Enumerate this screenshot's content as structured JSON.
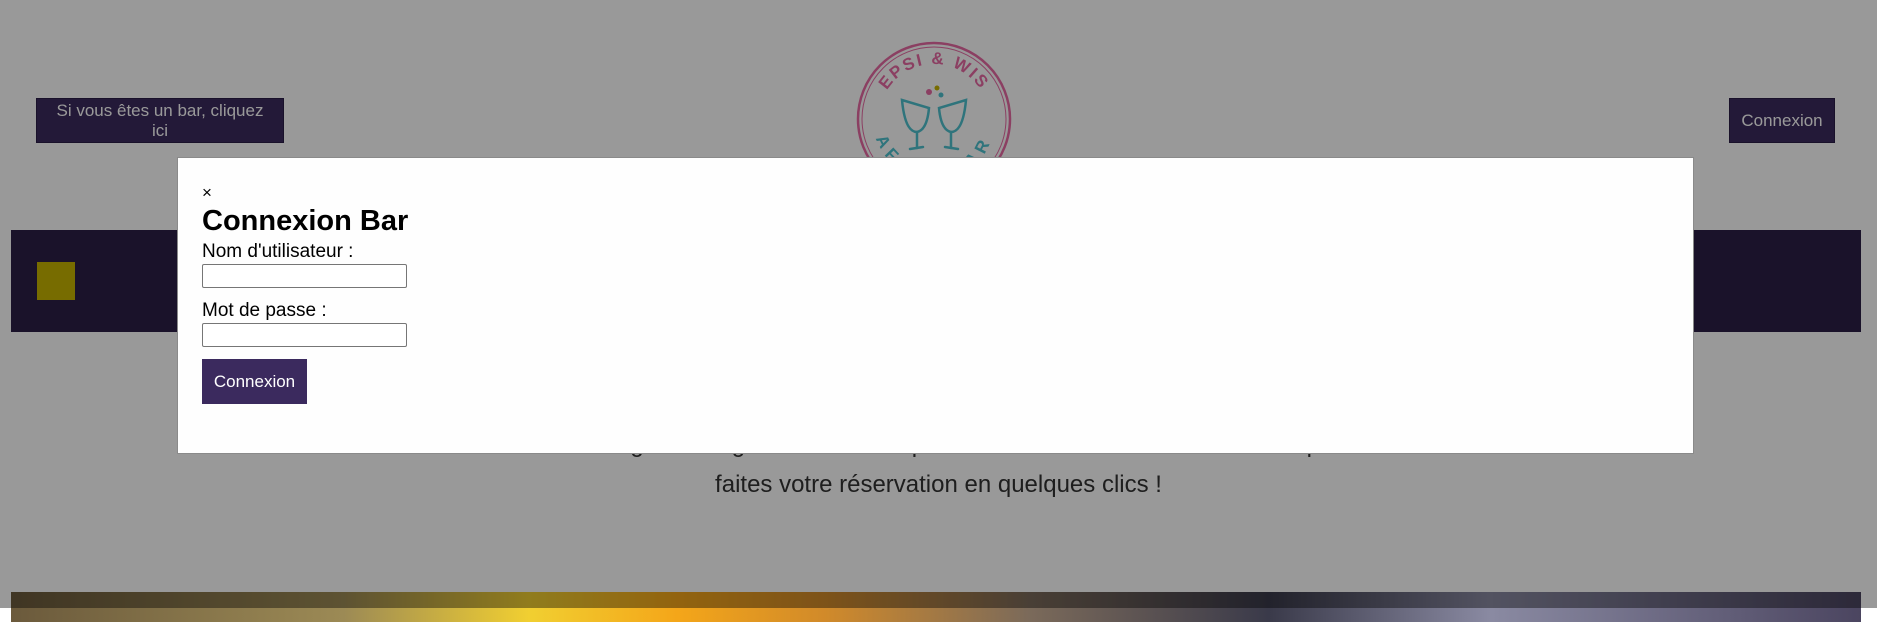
{
  "header": {
    "bar_button_label": "Si vous êtes un bar, cliquez ici",
    "login_button_label": "Connexion",
    "logo": {
      "top_text": "EPSI & WIS",
      "bottom_text": "AFTER BAR",
      "icon": "clinking-glasses-icon",
      "colors": {
        "ring": "#e86aa4",
        "text_top": "#e86aa4",
        "text_bottom": "#4fc2cf",
        "glasses": "#4fc2cf"
      }
    }
  },
  "main": {
    "intro_lines": [
      "directement en ligne. Naviguez ci-dessous pour découvrir les établissements disponibles et",
      "faites votre réservation en quelques clics !"
    ]
  },
  "modal": {
    "close_symbol": "×",
    "title": "Connexion Bar",
    "username_label": "Nom d'utilisateur :",
    "username_value": "",
    "password_label": "Mot de passe :",
    "password_value": "",
    "submit_label": "Connexion"
  },
  "colors": {
    "primary": "#3b2a5e",
    "nav_band": "#2c1f46",
    "nav_accent": "#c7b400",
    "overlay": "rgba(0,0,0,0.4)"
  }
}
